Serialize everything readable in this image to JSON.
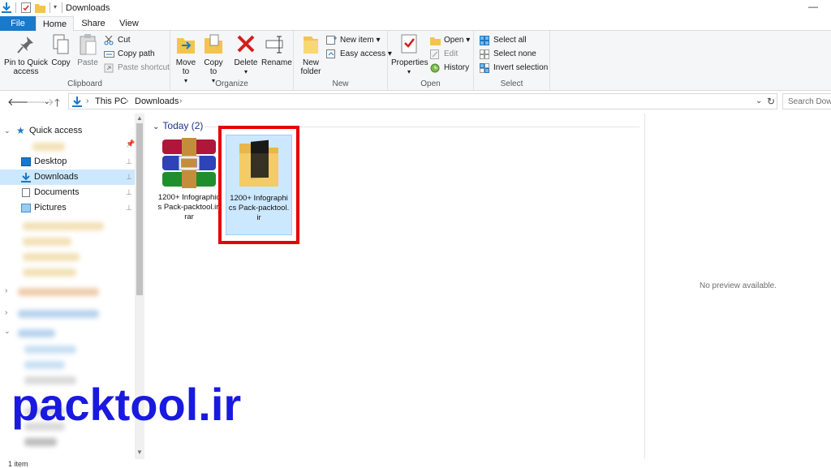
{
  "window": {
    "title": "Downloads"
  },
  "tabs": {
    "file": "File",
    "home": "Home",
    "share": "Share",
    "view": "View"
  },
  "ribbon": {
    "clipboard": {
      "label": "Clipboard",
      "pin": "Pin to Quick access",
      "copy": "Copy",
      "paste": "Paste",
      "cut": "Cut",
      "copy_path": "Copy path",
      "paste_shortcut": "Paste shortcut"
    },
    "organize": {
      "label": "Organize",
      "move_to": "Move to",
      "copy_to": "Copy to",
      "delete": "Delete",
      "rename": "Rename"
    },
    "new": {
      "label": "New",
      "new_folder": "New folder",
      "new_item": "New item",
      "easy_access": "Easy access"
    },
    "open": {
      "label": "Open",
      "properties": "Properties",
      "open": "Open",
      "edit": "Edit",
      "history": "History"
    },
    "select": {
      "label": "Select",
      "select_all": "Select all",
      "select_none": "Select none",
      "invert": "Invert selection"
    }
  },
  "address": {
    "crumbs": [
      "This PC",
      "Downloads"
    ],
    "search_placeholder": "Search Downloads"
  },
  "nav": {
    "quick_access": "Quick access",
    "items": [
      {
        "label": "Desktop",
        "icon": "desktop-icon"
      },
      {
        "label": "Downloads",
        "icon": "downloads-icon"
      },
      {
        "label": "Documents",
        "icon": "documents-icon"
      },
      {
        "label": "Pictures",
        "icon": "pictures-icon"
      }
    ]
  },
  "content": {
    "group_header": "Today (2)",
    "files": [
      {
        "name": "1200+ Infographics Pack-packtool.ir.rar",
        "icon": "winrar-archive-icon",
        "selected": false
      },
      {
        "name": "1200+ Infographics Pack-packtool.ir",
        "icon": "folder-icon",
        "selected": true
      }
    ]
  },
  "preview": {
    "text": "No preview available."
  },
  "status": {
    "text": "1 item"
  },
  "watermark": "packtool.ir",
  "colors": {
    "accent": "#1979ca",
    "selection": "#cce8ff",
    "highlight_box": "#e60000",
    "watermark": "#1919e0"
  }
}
